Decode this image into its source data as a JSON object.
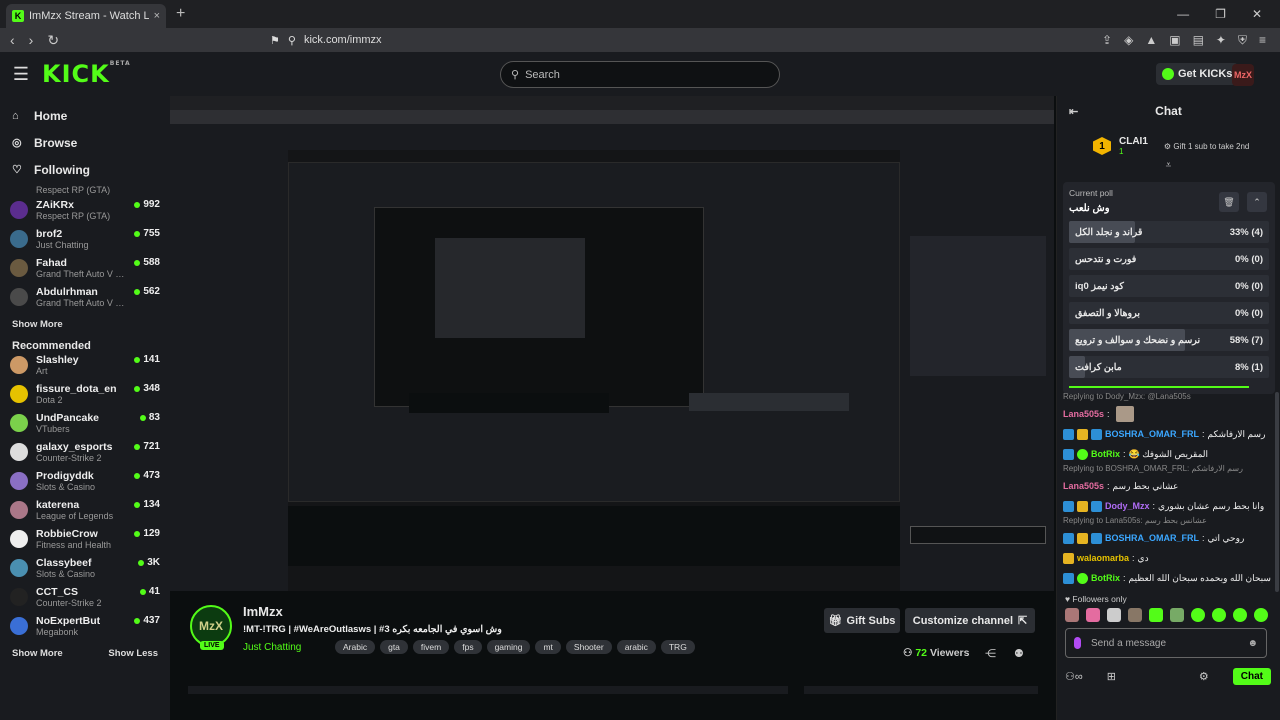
{
  "browser": {
    "tab_title": "ImMzx Stream - Watch Live o",
    "tab_close": "×",
    "new_tab": "+",
    "url": "kick.com/immzx",
    "win_min": "—",
    "win_max": "❐",
    "win_close": "✕"
  },
  "header": {
    "logo": "KICK",
    "logo_beta": "BETA",
    "search_placeholder": "Search",
    "get_kicks": "Get KICKs",
    "avatar": "MzX"
  },
  "sidebar": {
    "nav": [
      {
        "label": "Home",
        "icon": "home-icon",
        "glyph": "⌂"
      },
      {
        "label": "Browse",
        "icon": "compass-icon",
        "glyph": "◎"
      },
      {
        "label": "Following",
        "icon": "heart-icon",
        "glyph": "♡"
      }
    ],
    "following": [
      {
        "name": "",
        "category": "Respect RP (GTA)",
        "viewers": ""
      },
      {
        "name": "ZAiKRx",
        "category": "Respect RP (GTA)",
        "viewers": "992",
        "color": "#5b2d8e"
      },
      {
        "name": "brof2",
        "category": "Just Chatting",
        "viewers": "755",
        "color": "#3a6b8c"
      },
      {
        "name": "Fahad",
        "category": "Grand Theft Auto V (G...",
        "viewers": "588",
        "color": "#6a5a40"
      },
      {
        "name": "Abdulrhman",
        "category": "Grand Theft Auto V (G...",
        "viewers": "562",
        "color": "#4a4a4a"
      }
    ],
    "show_more": "Show More",
    "recommended_title": "Recommended",
    "recommended": [
      {
        "name": "Slashley",
        "category": "Art",
        "viewers": "141",
        "color": "#c96"
      },
      {
        "name": "fissure_dota_en",
        "category": "Dota 2",
        "viewers": "348",
        "color": "#e6c200"
      },
      {
        "name": "UndPancake",
        "category": "VTubers",
        "viewers": "83",
        "color": "#7bd14b"
      },
      {
        "name": "galaxy_esports",
        "category": "Counter-Strike 2",
        "viewers": "721",
        "color": "#ddd"
      },
      {
        "name": "Prodigyddk",
        "category": "Slots & Casino",
        "viewers": "473",
        "color": "#8a6fc4"
      },
      {
        "name": "katerena",
        "category": "League of Legends",
        "viewers": "134",
        "color": "#a78"
      },
      {
        "name": "RobbieCrow",
        "category": "Fitness and Health",
        "viewers": "129",
        "color": "#eee"
      },
      {
        "name": "Classybeef",
        "category": "Slots & Casino",
        "viewers": "3K",
        "color": "#4a8fb0"
      },
      {
        "name": "CCT_CS",
        "category": "Counter-Strike 2",
        "viewers": "41",
        "color": "#222"
      },
      {
        "name": "NoExpertBut",
        "category": "Megabonk",
        "viewers": "437",
        "color": "#3a6fd6"
      }
    ],
    "footer_more": "Show More",
    "footer_less": "Show Less"
  },
  "stream": {
    "avatar": "MzX",
    "live": "LIVE",
    "name": "ImMzx",
    "title": "!MT-!TRG | #WeAreOutlasws | #3 وش اسوي في الجامعه بكره",
    "category": "Just Chatting",
    "tags": [
      "Arabic",
      "gta",
      "fivem",
      "fps",
      "gaming",
      "mt",
      "Shooter",
      "arabic",
      "TRG"
    ],
    "gift_subs": "Gift Subs",
    "customize": "Customize channel",
    "viewers": "72",
    "viewers_label": "Viewers"
  },
  "chat": {
    "title": "Chat",
    "leader": {
      "rank": "1",
      "name": "CLAI1",
      "count": "1",
      "cta": "Gift 1 sub to take 2nd"
    },
    "poll": {
      "header": "Current poll",
      "question": "وش نلعب",
      "options": [
        {
          "label": "قراند و نجلد الكل",
          "pct": "33% (4)",
          "fill": 33
        },
        {
          "label": "فورت و نتدحس",
          "pct": "0% (0)",
          "fill": 0
        },
        {
          "label": "iq0 كود نيمز",
          "pct": "0% (0)",
          "fill": 0
        },
        {
          "label": "بروهالا و التصفق",
          "pct": "0% (0)",
          "fill": 0
        },
        {
          "label": "نرسم و نضحك و سوالف و ترويع",
          "pct": "58% (7)",
          "fill": 58
        },
        {
          "label": "مابن كرافت",
          "pct": "8% (1)",
          "fill": 8
        }
      ]
    },
    "messages": [
      {
        "reply": "Replying to Dody_Mzx: @Lana505s"
      },
      {
        "user": "Lana505s",
        "color": "#e46ca0",
        "text": "",
        "badges": []
      },
      {
        "user": "BOSHRA_OMAR_FRL",
        "color": "#3ba7ff",
        "text": "رسم الارفاشكم",
        "badges": [
          "b-blue",
          "b-gold",
          "b-blue"
        ]
      },
      {
        "user": "BotRix",
        "color": "#53fc18",
        "text": "المقريص الشوفك 😂",
        "badges": [
          "b-blue",
          "b-green"
        ]
      },
      {
        "reply": "Replying to BOSHRA_OMAR_FRL: رسم الارفاشكم"
      },
      {
        "user": "Lana505s",
        "color": "#e46ca0",
        "text": "عشاني بحط رسم",
        "badges": []
      },
      {
        "user": "Dody_Mzx",
        "color": "#b06cf5",
        "text": "وانا بحط رسم عشان بشوري",
        "badges": [
          "b-blue",
          "b-gold",
          "b-blue"
        ]
      },
      {
        "reply": "Replying to Lana505s: عشانس بحط رسم"
      },
      {
        "user": "BOSHRA_OMAR_FRL",
        "color": "#3ba7ff",
        "text": "روحي اتي",
        "badges": [
          "b-blue",
          "b-gold",
          "b-blue"
        ]
      },
      {
        "user": "walaomarba",
        "color": "#e6c200",
        "text": "دي",
        "badges": [
          "b-gold"
        ]
      },
      {
        "user": "BotRix",
        "color": "#53fc18",
        "text": "سبحان الله وبحمده سبحان الله العظيم",
        "badges": [
          "b-blue",
          "b-green"
        ]
      }
    ],
    "followers_only": "Followers only",
    "input_placeholder": "Send a message",
    "send": "Chat"
  }
}
